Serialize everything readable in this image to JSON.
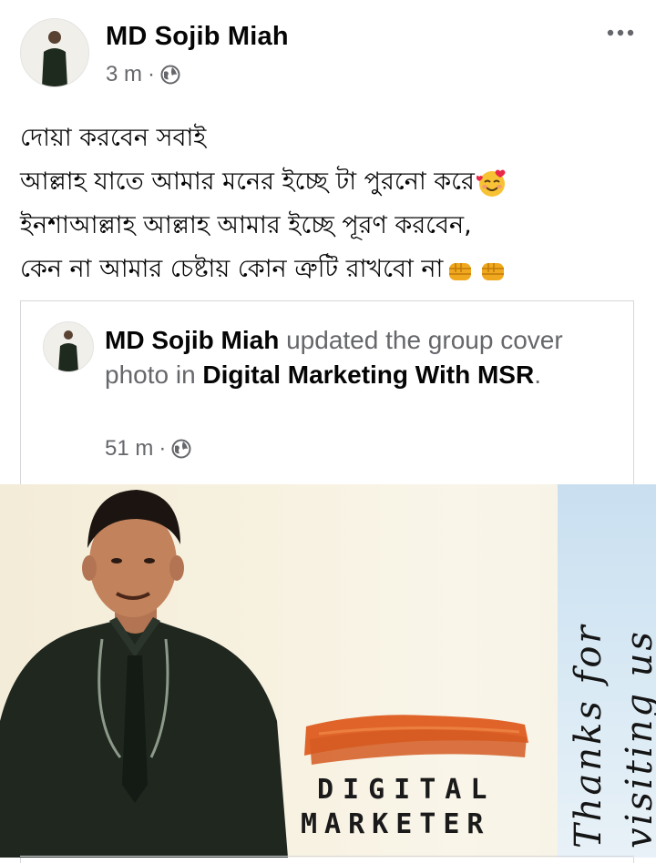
{
  "post": {
    "author": "MD Sojib Miah",
    "time": "3 m",
    "separator": "·",
    "lines": [
      "দোয়া করবেন সবাই",
      "আল্লাহ যাতে আমার মনের ইচ্ছে টা পুরনো করে",
      "ইনশাআল্লাহ আল্লাহ আমার ইচ্ছে পূরণ করবেন,",
      "কেন না আমার চেষ্টায় কোন ত্রুটি রাখবো না"
    ],
    "icons": {
      "more": "more-horizontal-icon",
      "audience": "globe-icon",
      "emoji_love": "smiling-face-with-hearts-emoji",
      "emoji_fist": "raised-fist-emoji"
    }
  },
  "shared": {
    "author": "MD Sojib Miah",
    "action_prefix": "updated the group cover photo in",
    "group": "Digital Marketing With MSR",
    "period": ".",
    "time": "51 m",
    "separator": "·"
  },
  "cover_photo": {
    "side_text_line1": "Thanks for",
    "side_text_line2": "visiting us",
    "brand_line1": "DIGITAL",
    "brand_line2": "MARKETER",
    "colors": {
      "brush": "#e0642a",
      "background": "#f6f0df",
      "side_band": "#d3e6f3"
    }
  }
}
